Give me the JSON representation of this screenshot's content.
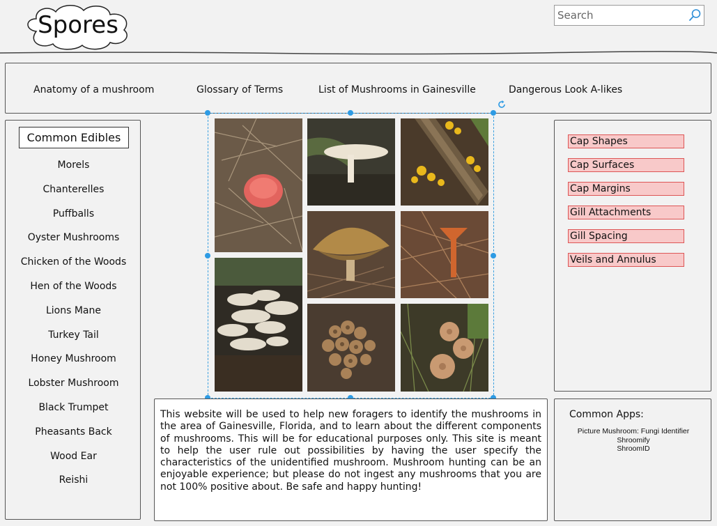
{
  "header": {
    "logo_text": "Spores",
    "search_placeholder": "Search"
  },
  "nav": {
    "items": [
      "Anatomy of a mushroom",
      "Glossary of Terms",
      "List of Mushrooms in Gainesville",
      "Dangerous Look A-likes"
    ]
  },
  "left_sidebar": {
    "title": "Common Edibles",
    "items": [
      "Morels",
      "Chanterelles",
      "Puffballs",
      "Oyster Mushrooms",
      "Chicken of the Woods",
      "Hen of the Woods",
      "Lions Mane",
      "Turkey Tail",
      "Honey Mushroom",
      "Lobster Mushroom",
      "Black Trumpet",
      "Pheasants Back",
      "Wood Ear",
      "Reishi"
    ]
  },
  "gallery": {
    "photos": [
      "red-cap-mushroom-photo",
      "white-gilled-mushroom-photo",
      "yellow-cluster-on-log-photo",
      "white-cluster-mushroom-photo",
      "brown-cap-mushroom-photo",
      "orange-trumpet-mushroom-photo",
      "brown-cluster-mushroom-photo",
      "tan-caps-in-grass-photo"
    ]
  },
  "right_sidebar": {
    "characteristics": [
      "Cap Shapes",
      "Cap Surfaces",
      "Cap Margins",
      "Gill Attachments",
      "Gill Spacing",
      "Veils and Annulus"
    ],
    "highlight_fill": "#f8c9c9",
    "highlight_border": "#dd5555"
  },
  "description": "This website will be used to help new foragers to identify the mushrooms in the area of Gainesville, Florida, and to learn about the different components of mushrooms. This will be for educational purposes only. This site is meant to help the user rule out possibilities by having the user specify the characteristics of the unidentified mushroom. Mushroom hunting can be an enjoyable experience; but please do not ingest any mushrooms that you are not 100% positive about. Be safe and happy hunting!",
  "apps": {
    "title": "Common Apps:",
    "items": [
      "Picture Mushroom: Fungi Identifier",
      "Shroomify",
      "ShroomID"
    ]
  },
  "colors": {
    "selection": "#2e9be4",
    "background": "#f2f2f2"
  }
}
